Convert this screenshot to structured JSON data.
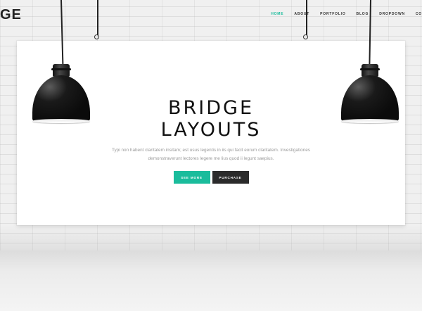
{
  "header": {
    "logo_fragment": "GE",
    "nav": [
      {
        "label": "HOME",
        "active": true
      },
      {
        "label": "ABOUT",
        "active": false
      },
      {
        "label": "PORTFOLIO",
        "active": false
      },
      {
        "label": "BLOG",
        "active": false
      },
      {
        "label": "DROPDOWN",
        "active": false
      },
      {
        "label": "CO",
        "active": false
      }
    ]
  },
  "hero": {
    "title_line_1": "BRIDGE",
    "title_line_2": "LAYOUTS",
    "text": "Typi non habent claritatem insitam; est usus legentis in iis qui facit eorum claritatem. Investigationes demonstraverunt lectores legere me lius quod ii legunt saepius.",
    "buttons": {
      "primary_label": "SEE MORE",
      "secondary_label": "PURCHASE"
    }
  },
  "colors": {
    "accent": "#1abc9c",
    "dark_button": "#2b2b2b",
    "title": "#111111",
    "body_text": "#9a9a9a"
  },
  "icons": {
    "left_lamp": "pendant-lamp-icon",
    "right_lamp": "pendant-lamp-icon",
    "left_hook": "hanging-hook-icon",
    "right_hook": "hanging-hook-icon"
  }
}
